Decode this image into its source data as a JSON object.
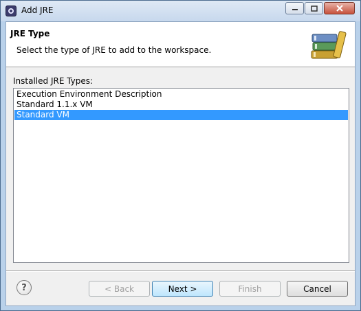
{
  "window": {
    "title": "Add JRE"
  },
  "header": {
    "title": "JRE Type",
    "description": "Select the type of JRE to add to the workspace.",
    "icon": "books-icon"
  },
  "list": {
    "label": "Installed JRE Types:",
    "items": [
      {
        "label": "Execution Environment Description",
        "selected": false
      },
      {
        "label": "Standard 1.1.x VM",
        "selected": false
      },
      {
        "label": "Standard VM",
        "selected": true
      }
    ],
    "selection_color": "#3399ff"
  },
  "buttons": {
    "help": "?",
    "back": "< Back",
    "next": "Next >",
    "finish": "Finish",
    "cancel": "Cancel"
  }
}
